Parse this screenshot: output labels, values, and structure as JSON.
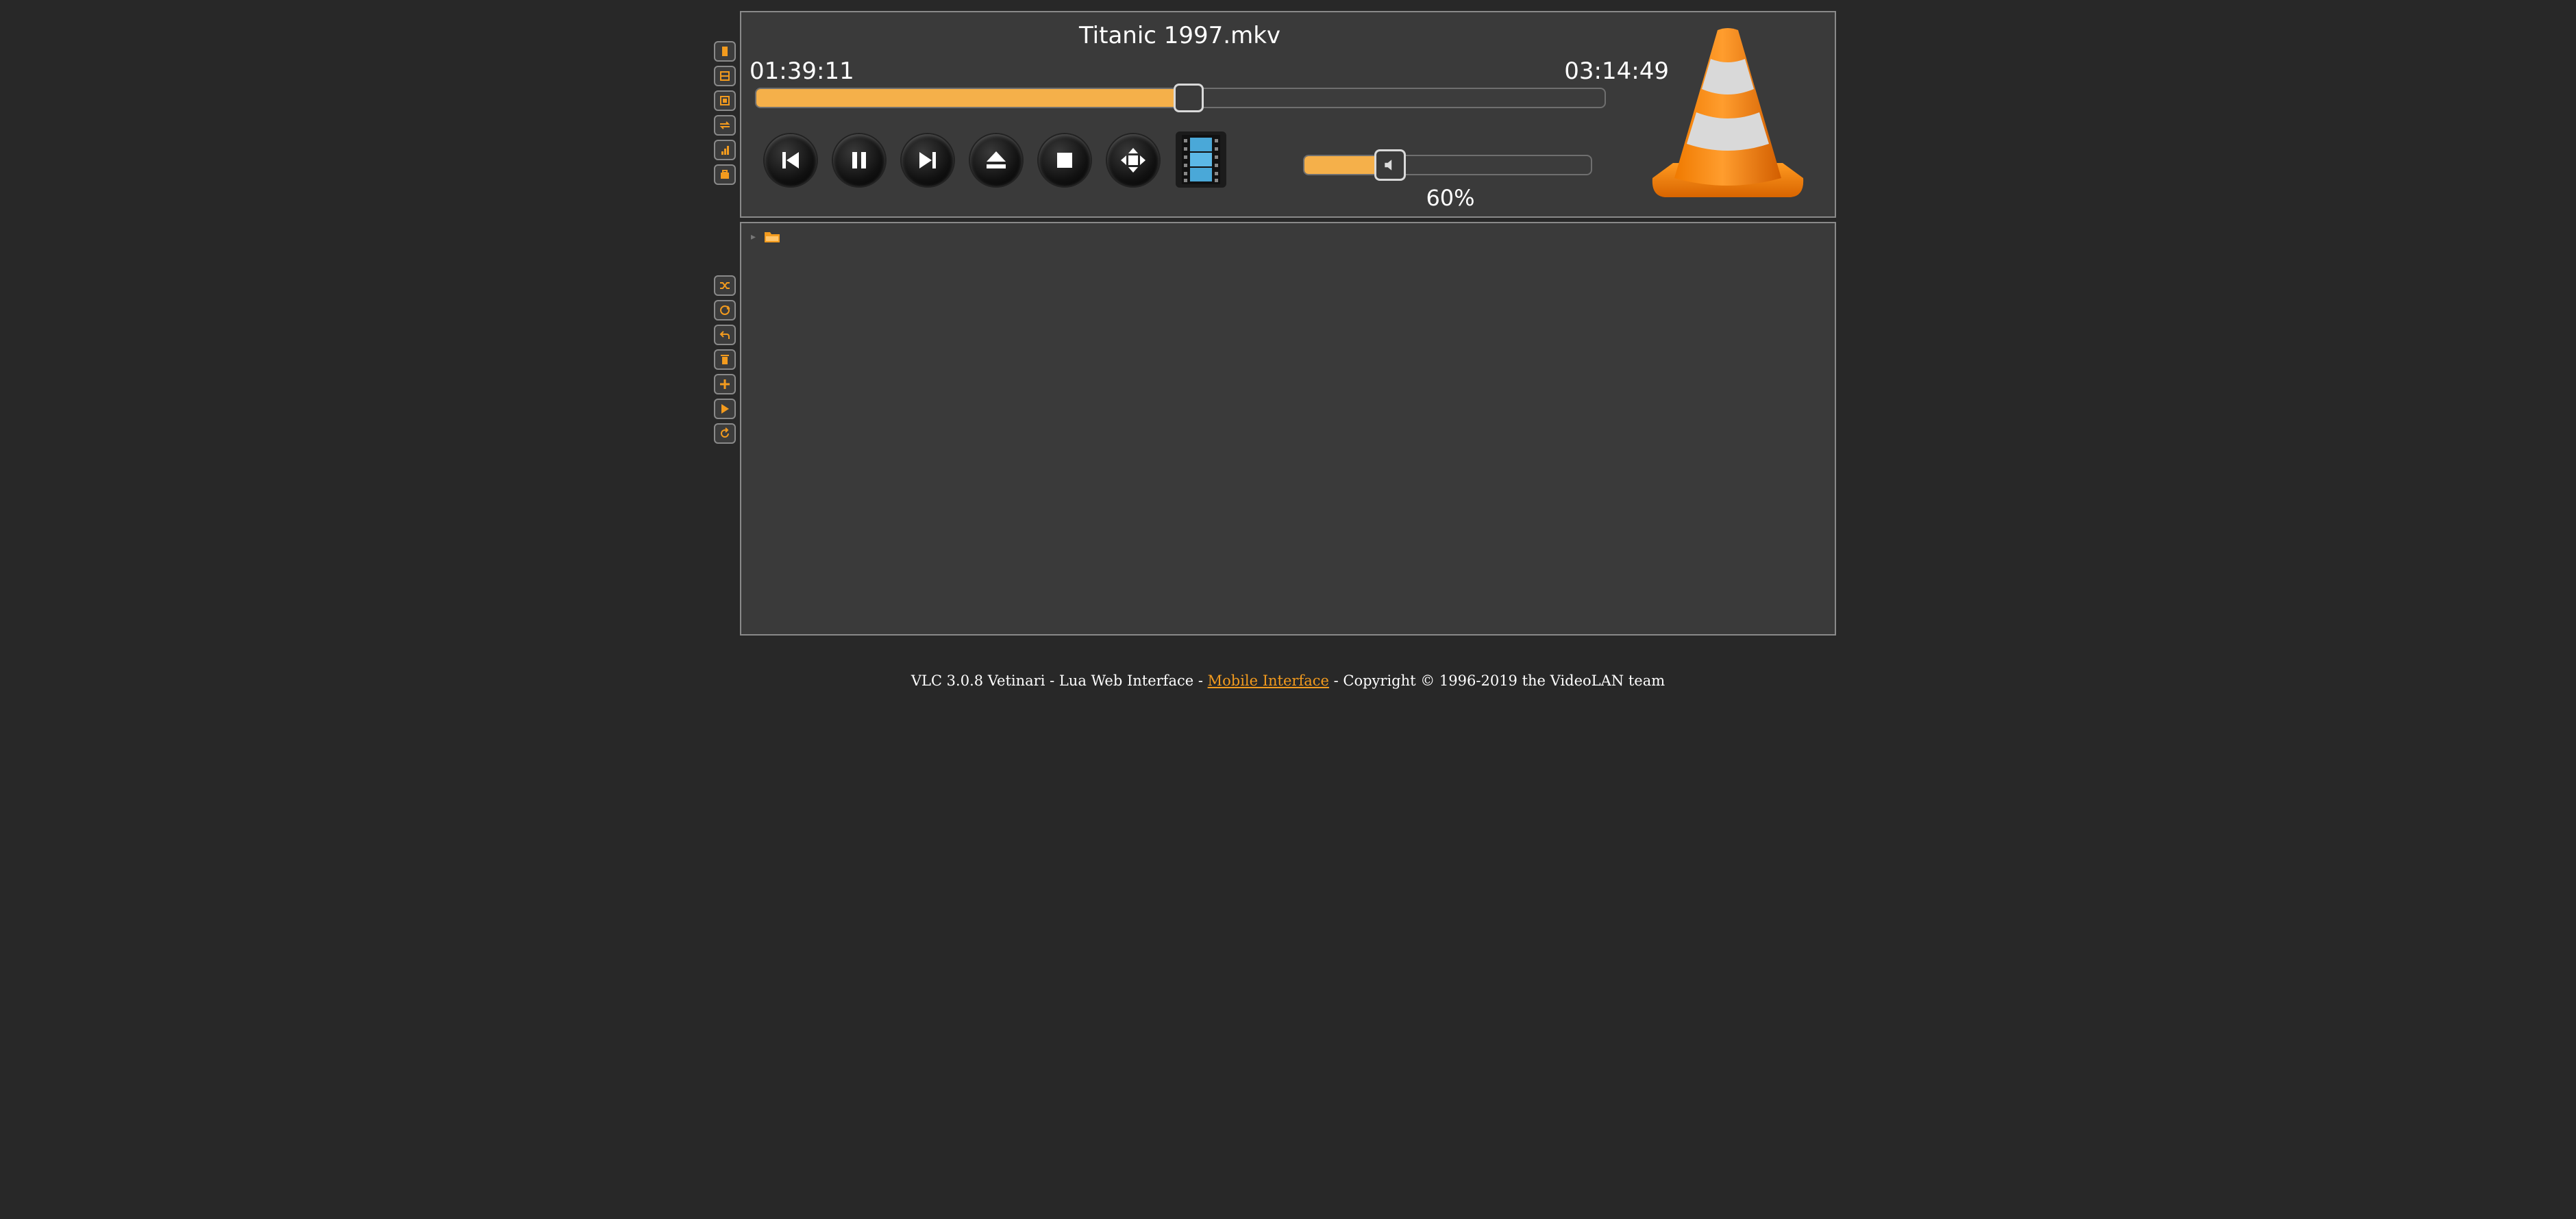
{
  "player": {
    "title": "Titanic 1997.mkv",
    "elapsed": "01:39:11",
    "total": "03:14:49",
    "progress_fraction": 0.51,
    "volume_label": "60%",
    "volume_fraction": 0.3
  },
  "controls": [
    {
      "name": "previous-button",
      "icon": "skip-back-icon"
    },
    {
      "name": "pause-button",
      "icon": "pause-icon"
    },
    {
      "name": "next-button",
      "icon": "skip-forward-icon"
    },
    {
      "name": "eject-button",
      "icon": "eject-icon"
    },
    {
      "name": "stop-button",
      "icon": "stop-icon"
    },
    {
      "name": "fullscreen-button",
      "icon": "fullscreen-icon"
    },
    {
      "name": "video-button",
      "icon": "film-icon"
    }
  ],
  "toolbar_top": [
    "open-media-icon",
    "playlist-icon",
    "toggle-window-icon",
    "stream-icon",
    "equalizer-icon",
    "battery-icon"
  ],
  "toolbar_playlist": [
    "shuffle-icon",
    "loop-icon",
    "repeat-icon",
    "delete-icon",
    "add-icon",
    "play-icon",
    "refresh-icon"
  ],
  "colors": {
    "accent": "#f5b04a",
    "link": "#f39b1e",
    "panel": "#3a3a3a",
    "background": "#282828"
  },
  "footer": {
    "prefix": "VLC 3.0.8 Vetinari - Lua Web Interface - ",
    "link_text": "Mobile Interface",
    "suffix": " - Copyright © 1996-2019 the VideoLAN team"
  }
}
